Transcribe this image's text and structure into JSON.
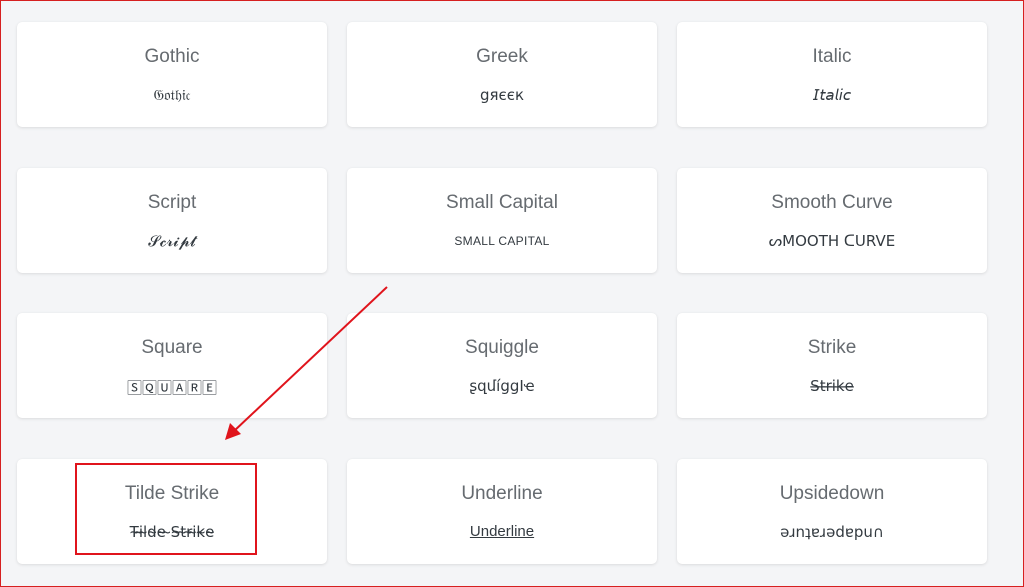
{
  "styles": [
    {
      "name": "Gothic",
      "sample": "𝔊𝔬𝔱𝔥𝔦𝔠",
      "kind": "normal"
    },
    {
      "name": "Greek",
      "sample": "gяєєк",
      "kind": "normal"
    },
    {
      "name": "Italic",
      "sample": "𝘐𝘵𝘢𝘭𝘪𝘤",
      "kind": "normal"
    },
    {
      "name": "Script",
      "sample": "𝓢𝓬𝓻𝓲𝓹𝓽",
      "kind": "normal"
    },
    {
      "name": "Small Capital",
      "sample": "SMALL CAPITAL",
      "kind": "smallcap"
    },
    {
      "name": "Smooth Curve",
      "sample": "ᔕMOOTH ᑕURVE",
      "kind": "normal"
    },
    {
      "name": "Square",
      "sample": "🅂🅀🅄🄰🅁🄴",
      "kind": "normal"
    },
    {
      "name": "Squiggle",
      "sample": "ʂզմíցցӀҽ",
      "kind": "normal"
    },
    {
      "name": "Strike",
      "sample": "S̶t̶r̶i̶k̶e̶",
      "kind": "normal"
    },
    {
      "name": "Tilde Strike",
      "sample": "T̴i̴l̴d̴e̴ ̴S̴t̴r̴i̴k̴e̴",
      "kind": "normal"
    },
    {
      "name": "Underline",
      "sample": "Underline",
      "kind": "underline"
    },
    {
      "name": "Upsidedown",
      "sample": "ǝɹnʇɐɹǝdɐpu∩",
      "kind": "normal"
    }
  ],
  "highlight_color": "#e0141c"
}
